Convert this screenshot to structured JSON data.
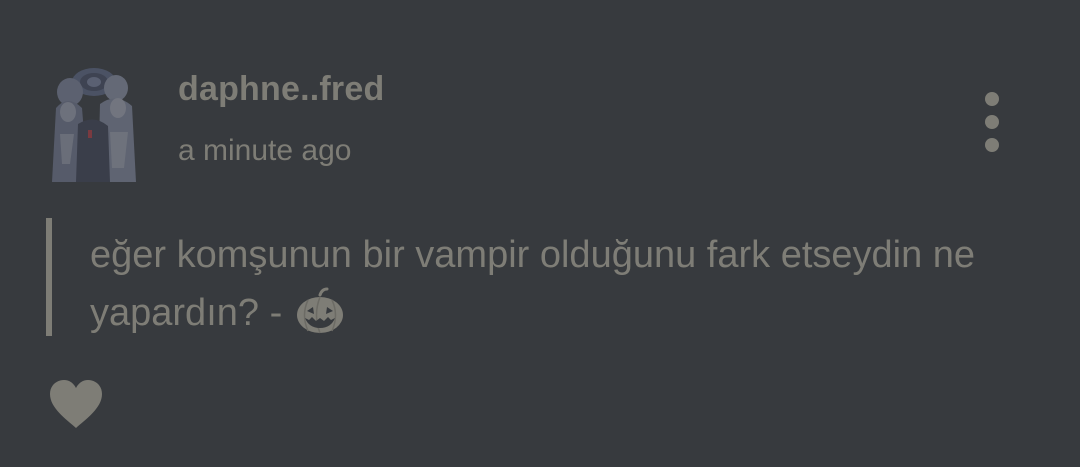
{
  "post": {
    "author": "daphne..fred",
    "timestamp": "a minute ago",
    "body_text": "eğer komşunun bir vampir olduğunu fark etseydin ne yapardın? -",
    "body_icon": "jack-o-lantern-icon"
  },
  "actions": {
    "more_icon": "more-vertical-icon",
    "like_icon": "heart-icon"
  },
  "colors": {
    "background": "#373a3e",
    "text": "#7e7d76",
    "quote_bar": "#7e7d76"
  }
}
